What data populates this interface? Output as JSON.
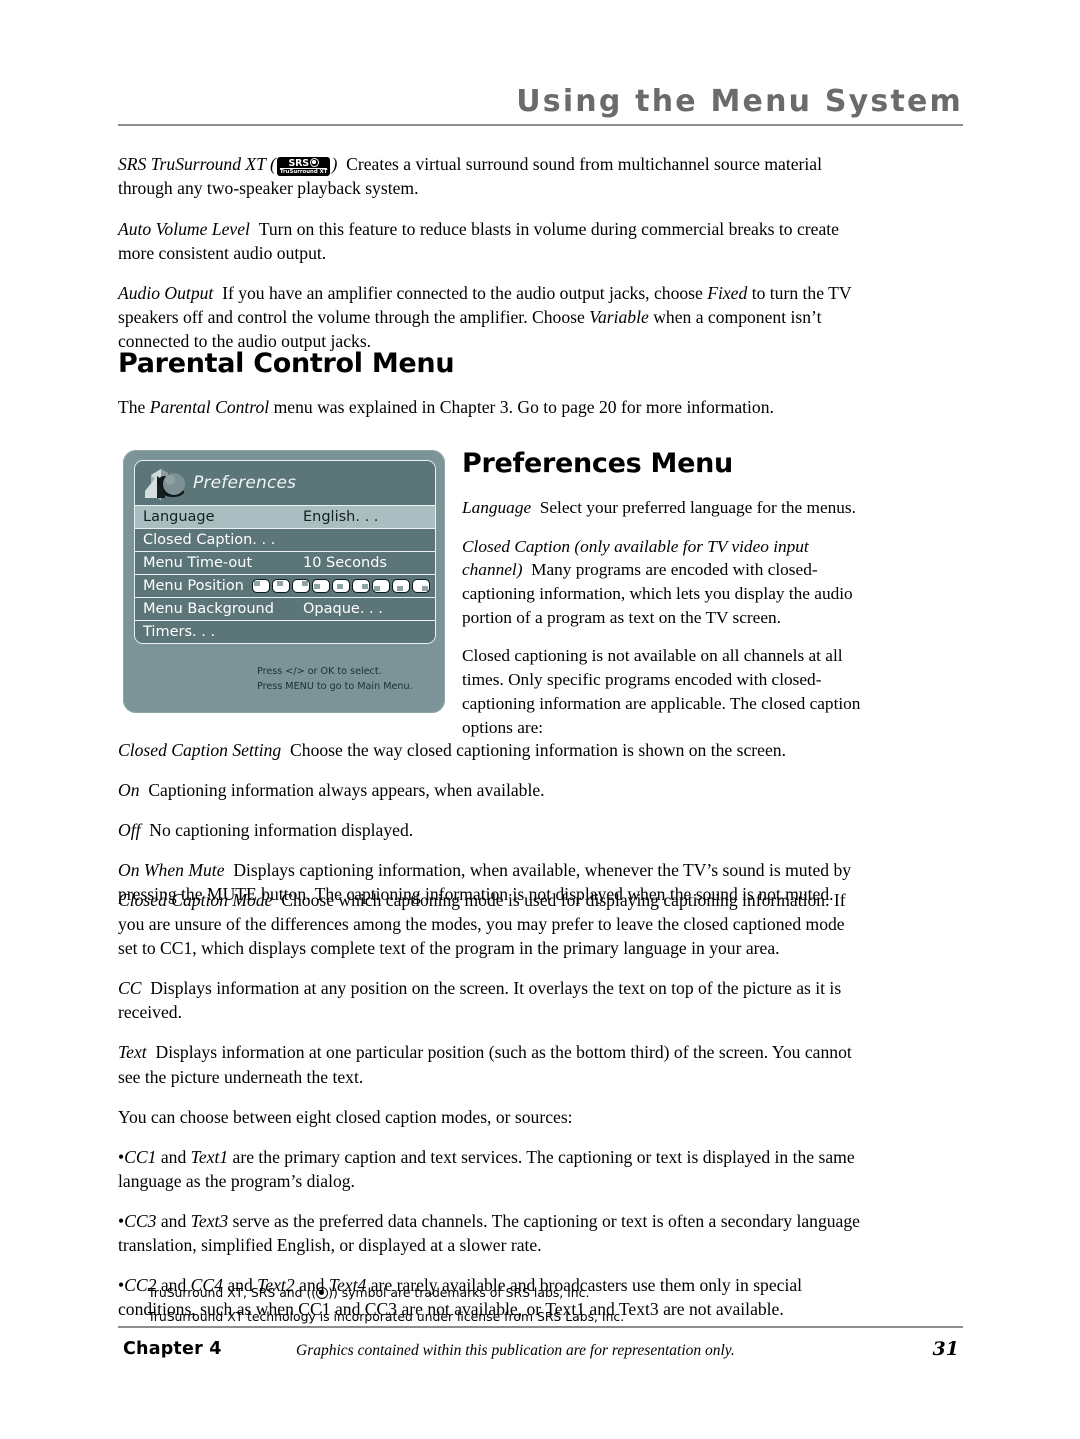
{
  "header": {
    "running_head": "Using the Menu System"
  },
  "audio_section": {
    "srs": {
      "term": "SRS TruSurround XT (",
      "logo_top": "SRS",
      "logo_bottom": "TruSurround XT",
      "term_close": ")",
      "text": "Creates a virtual surround sound from multichannel source material through any two-speaker playback system."
    },
    "auto_volume": {
      "term": "Auto Volume Level",
      "text": "Turn on this feature to reduce blasts in volume during commercial breaks to create more consistent audio output."
    },
    "audio_output": {
      "term": "Audio Output",
      "text_1": "If you have an amplifier connected to the audio output jacks, choose ",
      "em_1": "Fixed",
      "text_2": " to turn the TV speakers off and control the volume through the amplifier. Choose ",
      "em_2": "Variable",
      "text_3": " when a component isn’t connected to the audio output jacks."
    }
  },
  "parental_control": {
    "title": "Parental Control Menu",
    "intro_1": "The ",
    "intro_em": "Parental Control",
    "intro_2": " menu was explained in Chapter 3. Go to page 20 for more information."
  },
  "menu_graphic": {
    "title": "Preferences",
    "rows": [
      {
        "label": "Language",
        "value": "English. . .",
        "selected": true,
        "kind": "value"
      },
      {
        "label": "Closed Caption. . .",
        "value": "",
        "selected": false,
        "kind": "value"
      },
      {
        "label": "Menu Time-out",
        "value": "10 Seconds",
        "selected": false,
        "kind": "value"
      },
      {
        "label": "Menu Position",
        "value": "",
        "selected": false,
        "kind": "positions"
      },
      {
        "label": "Menu Background",
        "value": "Opaque. . .",
        "selected": false,
        "kind": "value"
      },
      {
        "label": "Timers. . .",
        "value": "",
        "selected": false,
        "kind": "value"
      }
    ],
    "position_icons": [
      "tl",
      "tc",
      "tr",
      "ml",
      "mc",
      "mr",
      "bl",
      "bc",
      "br"
    ],
    "hint_line_1": "Press </> or OK to select.",
    "hint_line_2": "Press MENU to go to Main Menu.",
    "colors": {
      "panel": "#7c9498",
      "row": "#5c7579",
      "row_selected": "#aabec2",
      "border": "#e9f0f1",
      "text": "#ffffff"
    }
  },
  "preferences_section": {
    "title": "Preferences Menu",
    "language": {
      "term": "Language",
      "text": "Select your preferred language for the menus."
    },
    "closed_caption": {
      "term": "Closed Caption (only available for TV video input channel)",
      "text": "Many programs are encoded with closed-captioning information, which lets you display the audio portion of a program as text on the TV screen."
    },
    "availability": "Closed captioning is not available on all channels at all times. Only specific programs encoded with closed-captioning information are applicable. The closed caption options are:"
  },
  "cc_setting": {
    "term": "Closed Caption Setting",
    "text": "Choose the way closed captioning information is shown on the screen.",
    "options": [
      {
        "term": "On",
        "text": "Captioning information always appears, when available."
      },
      {
        "term": "Off",
        "text": "No captioning information displayed."
      },
      {
        "term": "On When Mute",
        "text": "Displays captioning information, when available, whenever the TV’s sound is muted by pressing the MUTE button. The captioning information is not displayed when the sound is not muted."
      }
    ]
  },
  "cc_mode": {
    "term": "Closed Caption Mode",
    "text": "Choose which captioning mode is used for displaying captioning information. If you are unsure of the differences among the modes, you may prefer to leave the closed captioned mode set to CC1, which displays complete text of the program in the primary language in your area.",
    "options": [
      {
        "term": "CC",
        "text": "Displays information at any position on the screen. It overlays the text on top of the picture as it is received."
      },
      {
        "term": "Text",
        "text": "Displays information at one particular position (such as the bottom third) of the screen. You cannot see the picture underneath the text."
      }
    ],
    "modes_intro": "You can choose between eight closed caption modes, or sources:",
    "bullets": [
      {
        "bullet": "•",
        "em_1": "CC1",
        "mid_1": " and ",
        "em_2": "Text1",
        "rest": " are the primary caption and text services. The captioning or text is displayed in the same language as the program’s dialog."
      },
      {
        "bullet": "•",
        "em_1": "CC3",
        "mid_1": " and ",
        "em_2": "Text3",
        "rest": " serve as the preferred data channels. The captioning or text is often a secondary language translation, simplified English, or displayed at a slower rate."
      },
      {
        "bullet": "•",
        "em_1": "CC2",
        "mid_1": " and ",
        "em_2": "CC4",
        "mid_2": " and ",
        "em_3": "Text2",
        "mid_3": " and ",
        "em_4": "Text4",
        "rest": " are rarely available and broadcasters use them only in special conditions, such as when CC1 and CC3 are not available, or Text1 and Text3 are not available."
      }
    ]
  },
  "trademarks": {
    "line_1_a": "TruSurround XT, SRS and ((",
    "line_1_b": ")) symbol are trademarks of SRS labs, Inc.",
    "line_2": "TruSurround XT technology is incorporated under license from SRS Labs, Inc."
  },
  "footer": {
    "chapter": "Chapter 4",
    "note": "Graphics contained within this publication are for representation only.",
    "page": "31"
  }
}
